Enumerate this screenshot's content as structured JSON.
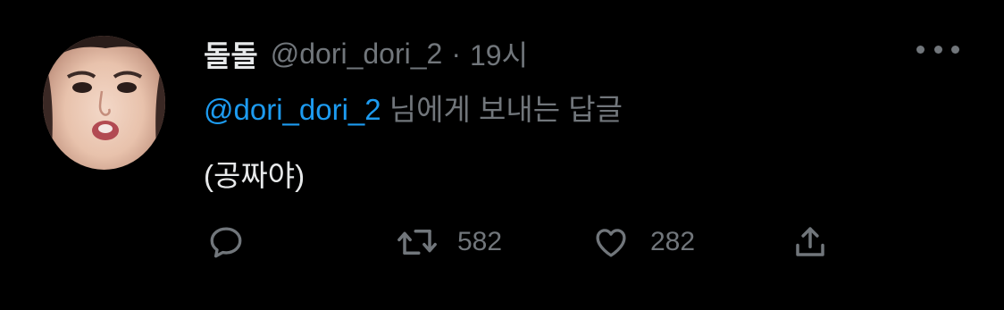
{
  "tweet": {
    "display_name": "돌돌",
    "handle": "@dori_dori_2",
    "separator": "·",
    "time": "19시",
    "reply_to_mention": "@dori_dori_2",
    "reply_to_suffix": " 님에게 보내는 답글",
    "text": "(공짜야)"
  },
  "actions": {
    "reply_icon": "speech-bubble-icon",
    "retweet_icon": "retweet-icon",
    "retweet_count": "582",
    "like_icon": "heart-icon",
    "like_count": "282",
    "share_icon": "share-upload-icon"
  },
  "colors": {
    "background": "#000000",
    "primary_text": "#e7e9ea",
    "secondary_text": "#71767b",
    "link": "#1d9bf0"
  }
}
